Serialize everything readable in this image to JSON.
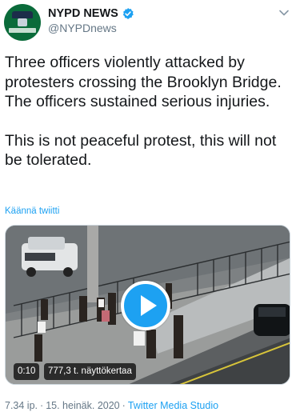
{
  "header": {
    "display_name": "NYPD NEWS",
    "handle": "@NYPDnews"
  },
  "tweet": {
    "paragraph_1": "Three officers violently attacked by protesters crossing the Brooklyn Bridge. The officers sustained serious injuries.",
    "paragraph_2": "This is not peaceful protest, this will not be tolerated.",
    "translate_label": "Käännä twiitti"
  },
  "media": {
    "duration": "0:10",
    "views": "777,3 t. näyttökertaa"
  },
  "meta": {
    "time": "7.34 ip.",
    "date": "15. heinäk. 2020",
    "separator": "·",
    "source": "Twitter Media Studio"
  },
  "colors": {
    "accent": "#1da1f2",
    "secondary_text": "#657786",
    "avatar_bg": "#0a6b3a"
  }
}
